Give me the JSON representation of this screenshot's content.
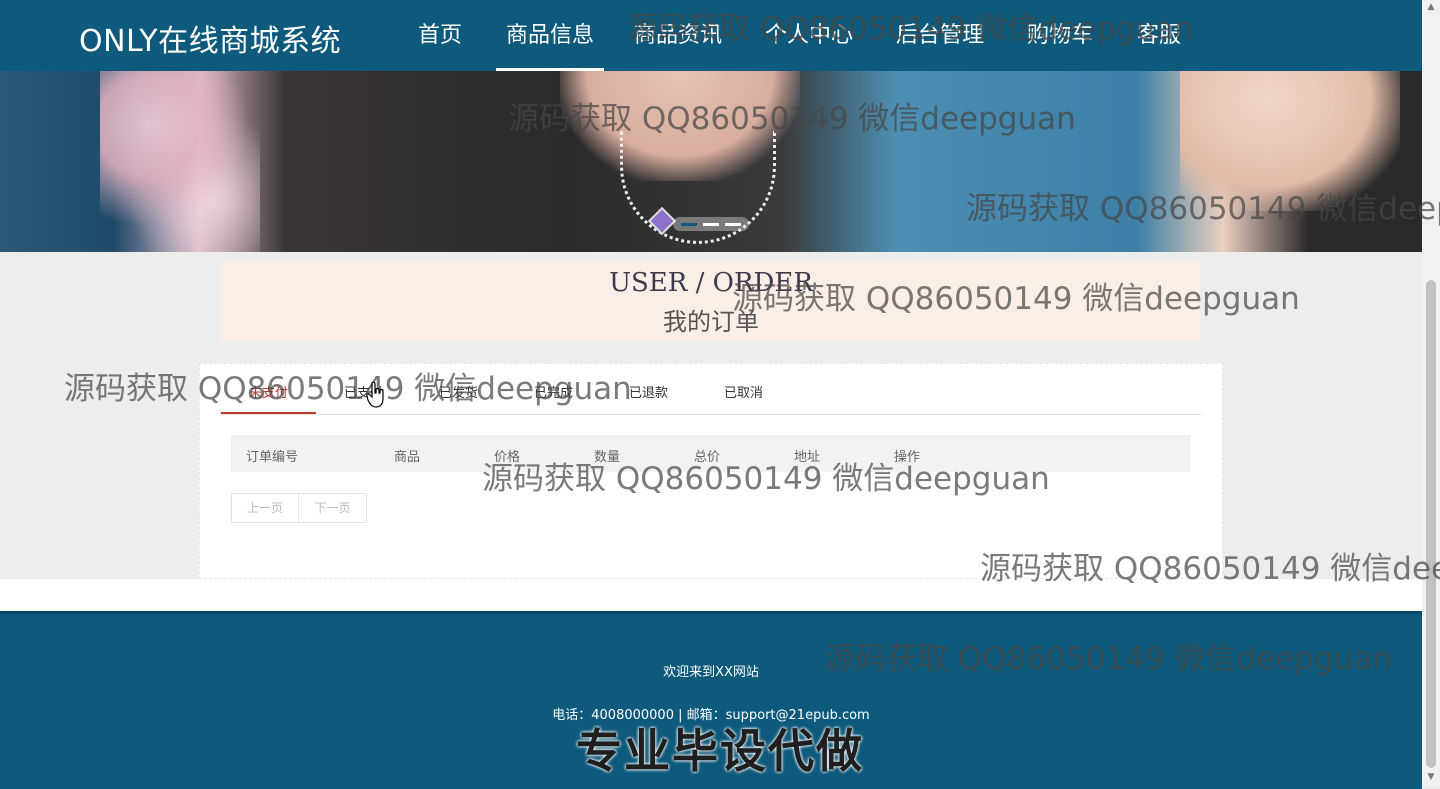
{
  "header": {
    "brand": "ONLY在线商城系统",
    "nav": [
      {
        "label": "首页"
      },
      {
        "label": "商品信息"
      },
      {
        "label": "商品资讯"
      },
      {
        "label": "个人中心"
      },
      {
        "label": "后台管理"
      },
      {
        "label": "购物车"
      },
      {
        "label": "客服"
      }
    ],
    "active_nav": "商品信息"
  },
  "banner": {
    "carousel_count": 3,
    "carousel_active_index": 0
  },
  "section_title": {
    "en": "USER / ORDER",
    "cn": "我的订单"
  },
  "orders": {
    "tabs": [
      {
        "label": "未支付"
      },
      {
        "label": "已支付"
      },
      {
        "label": "已发货"
      },
      {
        "label": "已完成"
      },
      {
        "label": "已退款"
      },
      {
        "label": "已取消"
      }
    ],
    "active_tab": "未支付",
    "columns": [
      "订单编号",
      "商品",
      "价格",
      "数量",
      "总价",
      "地址",
      "操作"
    ],
    "rows": [],
    "pager": {
      "prev": "上一页",
      "next": "下一页"
    }
  },
  "footer": {
    "welcome": "欢迎来到XX网站",
    "contact": "电话：4008000000 | 邮箱：support@21epub.com",
    "overlay": "专业毕设代做"
  },
  "watermarks": [
    "源码获取 QQ86050149 微信deepguan",
    "源码获取 QQ86050149 微信deepguan",
    "源码获取 QQ86050149 微信deepg",
    "源码获取 QQ86050149 微信deepguan",
    "源码获取 QQ86050149 微信deepguan",
    "源码获取 QQ86050149 微信deepguan",
    "源码获取 QQ86050149 微信deep",
    "源码获取 QQ86050149 微信deepguan"
  ],
  "colors": {
    "nav_bg": "#0e5a7c",
    "footer_bg": "#0e5a7c",
    "active_tab": "#c0392b",
    "title_box": "#fbeee6",
    "page_bg": "#ededeb"
  },
  "icons": [
    "mouse-pointer-hand-icon",
    "scroll-up-arrow-icon",
    "scroll-down-arrow-icon"
  ]
}
